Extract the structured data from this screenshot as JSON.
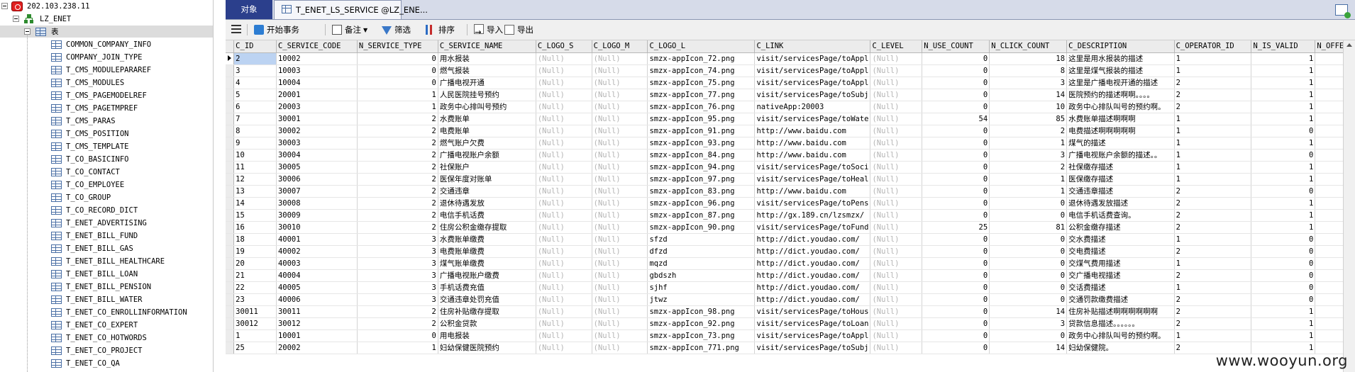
{
  "tree": {
    "connection": "202.103.238.11",
    "database": "LZ_ENET",
    "folder": "表",
    "tables": [
      "COMMON_COMPANY_INFO",
      "COMPANY_JOIN_TYPE",
      "T_CMS_MODULEPARAREF",
      "T_CMS_MODULES",
      "T_CMS_PAGEMODELREF",
      "T_CMS_PAGETMPREF",
      "T_CMS_PARAS",
      "T_CMS_POSITION",
      "T_CMS_TEMPLATE",
      "T_CO_BASICINFO",
      "T_CO_CONTACT",
      "T_CO_EMPLOYEE",
      "T_CO_GROUP",
      "T_CO_RECORD_DICT",
      "T_ENET_ADVERTISING",
      "T_ENET_BILL_FUND",
      "T_ENET_BILL_GAS",
      "T_ENET_BILL_HEALTHCARE",
      "T_ENET_BILL_LOAN",
      "T_ENET_BILL_PENSION",
      "T_ENET_BILL_WATER",
      "T_ENET_CO_ENROLLINFORMATION",
      "T_ENET_CO_EXPERT",
      "T_ENET_CO_HOTWORDS",
      "T_ENET_CO_PROJECT",
      "T_ENET_CO_QA"
    ]
  },
  "tabs": {
    "objects": "对象",
    "table": "T_ENET_LS_SERVICE @LZ_ENE..."
  },
  "toolbar": {
    "begin_tx": "开始事务",
    "note": "备注",
    "filter": "筛选",
    "sort": "排序",
    "import": "导入",
    "export": "导出"
  },
  "grid": {
    "columns": [
      "C_ID",
      "C_SERVICE_CODE",
      "N_SERVICE_TYPE",
      "C_SERVICE_NAME",
      "C_LOGO_S",
      "C_LOGO_M",
      "C_LOGO_L",
      "C_LINK",
      "C_LEVEL",
      "N_USE_COUNT",
      "N_CLICK_COUNT",
      "C_DESCRIPTION",
      "C_OPERATOR_ID",
      "N_IS_VALID",
      "N_OFFERI"
    ],
    "rows": [
      [
        "2",
        "10002",
        "0",
        "用水报装",
        "(Null)",
        "(Null)",
        "smzx-appIcon_72.png",
        "visit/servicesPage/toAppl",
        "(Null)",
        "0",
        "18",
        "这里是用水报装的描述",
        "1",
        "1",
        ""
      ],
      [
        "3",
        "10003",
        "0",
        "燃气报装",
        "(Null)",
        "(Null)",
        "smzx-appIcon_74.png",
        "visit/servicesPage/toAppl",
        "(Null)",
        "0",
        "8",
        "这里是煤气报装的描述",
        "1",
        "1",
        ""
      ],
      [
        "4",
        "10004",
        "0",
        "广播电视开通",
        "(Null)",
        "(Null)",
        "smzx-appIcon_75.png",
        "visit/servicesPage/toAppl",
        "(Null)",
        "0",
        "3",
        "这里是广播电视开通的描述",
        "2",
        "1",
        ""
      ],
      [
        "5",
        "20001",
        "1",
        "人民医院挂号预约",
        "(Null)",
        "(Null)",
        "smzx-appIcon_77.png",
        "visit/servicesPage/toSubj",
        "(Null)",
        "0",
        "14",
        "医院预约的描述啊啊。。。。",
        "2",
        "1",
        ""
      ],
      [
        "6",
        "20003",
        "1",
        "政务中心排叫号预约",
        "(Null)",
        "(Null)",
        "smzx-appIcon_76.png",
        "nativeApp:20003",
        "(Null)",
        "0",
        "10",
        "政务中心排队叫号的预约啊。",
        "2",
        "1",
        ""
      ],
      [
        "7",
        "30001",
        "2",
        "水费账单",
        "(Null)",
        "(Null)",
        "smzx-appIcon_95.png",
        "visit/servicesPage/toWate",
        "(Null)",
        "54",
        "85",
        "水费账单描述啊啊啊",
        "1",
        "1",
        ""
      ],
      [
        "8",
        "30002",
        "2",
        "电费账单",
        "(Null)",
        "(Null)",
        "smzx-appIcon_91.png",
        "http://www.baidu.com",
        "(Null)",
        "0",
        "2",
        "电费描述啊啊啊啊啊",
        "1",
        "0",
        ""
      ],
      [
        "9",
        "30003",
        "2",
        "燃气账户欠费",
        "(Null)",
        "(Null)",
        "smzx-appIcon_93.png",
        "http://www.baidu.com",
        "(Null)",
        "0",
        "1",
        "煤气的描述",
        "1",
        "1",
        ""
      ],
      [
        "10",
        "30004",
        "2",
        "广播电视账户余额",
        "(Null)",
        "(Null)",
        "smzx-appIcon_84.png",
        "http://www.baidu.com",
        "(Null)",
        "0",
        "3",
        "广播电视账户余额的描述。。",
        "1",
        "0",
        ""
      ],
      [
        "11",
        "30005",
        "2",
        "社保账户",
        "(Null)",
        "(Null)",
        "smzx-appIcon_94.png",
        "visit/servicesPage/toSoci",
        "(Null)",
        "0",
        "2",
        "社保缴存描述",
        "1",
        "1",
        ""
      ],
      [
        "12",
        "30006",
        "2",
        "医保年度对账单",
        "(Null)",
        "(Null)",
        "smzx-appIcon_97.png",
        "visit/servicesPage/toHeal",
        "(Null)",
        "0",
        "1",
        "医保缴存描述",
        "1",
        "1",
        ""
      ],
      [
        "13",
        "30007",
        "2",
        "交通违章",
        "(Null)",
        "(Null)",
        "smzx-appIcon_83.png",
        "http://www.baidu.com",
        "(Null)",
        "0",
        "1",
        "交通违章描述",
        "2",
        "0",
        ""
      ],
      [
        "14",
        "30008",
        "2",
        "退休待遇发放",
        "(Null)",
        "(Null)",
        "smzx-appIcon_96.png",
        "visit/servicesPage/toPens",
        "(Null)",
        "0",
        "0",
        "退休待遇发放描述",
        "2",
        "1",
        ""
      ],
      [
        "15",
        "30009",
        "2",
        "电信手机话费",
        "(Null)",
        "(Null)",
        "smzx-appIcon_87.png",
        "http://gx.189.cn/lzsmzx/",
        "(Null)",
        "0",
        "0",
        "电信手机话费查询。",
        "2",
        "1",
        ""
      ],
      [
        "16",
        "30010",
        "2",
        "住房公积金缴存提取",
        "(Null)",
        "(Null)",
        "smzx-appIcon_90.png",
        "visit/servicesPage/toFund",
        "(Null)",
        "25",
        "81",
        "公积金缴存描述",
        "2",
        "1",
        ""
      ],
      [
        "18",
        "40001",
        "3",
        "水费账单缴费",
        "(Null)",
        "(Null)",
        "sfzd",
        "http://dict.youdao.com/",
        "(Null)",
        "0",
        "0",
        "交水费描述",
        "1",
        "0",
        ""
      ],
      [
        "19",
        "40002",
        "3",
        "电费账单缴费",
        "(Null)",
        "(Null)",
        "dfzd",
        "http://dict.youdao.com/",
        "(Null)",
        "0",
        "0",
        "交电费描述",
        "2",
        "0",
        ""
      ],
      [
        "20",
        "40003",
        "3",
        "煤气账单缴费",
        "(Null)",
        "(Null)",
        "mqzd",
        "http://dict.youdao.com/",
        "(Null)",
        "0",
        "0",
        "交煤气费用描述",
        "1",
        "0",
        ""
      ],
      [
        "21",
        "40004",
        "3",
        "广播电视账户缴费",
        "(Null)",
        "(Null)",
        "gbdszh",
        "http://dict.youdao.com/",
        "(Null)",
        "0",
        "0",
        "交广播电视描述",
        "2",
        "0",
        ""
      ],
      [
        "22",
        "40005",
        "3",
        "手机话费充值",
        "(Null)",
        "(Null)",
        "sjhf",
        "http://dict.youdao.com/",
        "(Null)",
        "0",
        "0",
        "交话费描述",
        "1",
        "0",
        ""
      ],
      [
        "23",
        "40006",
        "3",
        "交通违章处罚充值",
        "(Null)",
        "(Null)",
        "jtwz",
        "http://dict.youdao.com/",
        "(Null)",
        "0",
        "0",
        "交通罚款缴费描述",
        "2",
        "0",
        ""
      ],
      [
        "30011",
        "30011",
        "2",
        "住房补贴缴存提取",
        "(Null)",
        "(Null)",
        "smzx-appIcon_98.png",
        "visit/servicesPage/toHous",
        "(Null)",
        "0",
        "14",
        "住房补贴描述啊啊啊啊啊啊",
        "2",
        "1",
        ""
      ],
      [
        "30012",
        "30012",
        "2",
        "公积金贷款",
        "(Null)",
        "(Null)",
        "smzx-appIcon_92.png",
        "visit/servicesPage/toLoan",
        "(Null)",
        "0",
        "3",
        "贷款信息描述。。。。。。",
        "2",
        "1",
        ""
      ],
      [
        "1",
        "10001",
        "0",
        "用电报装",
        "(Null)",
        "(Null)",
        "smzx-appIcon_73.png",
        "visit/servicesPage/toAppl",
        "(Null)",
        "0",
        "0",
        "政务中心排队叫号的预约啊。",
        "1",
        "1",
        ""
      ],
      [
        "25",
        "20002",
        "1",
        "妇幼保健医院预约",
        "(Null)",
        "(Null)",
        "smzx-appIcon_771.png",
        "visit/servicesPage/toSubj",
        "(Null)",
        "0",
        "14",
        "妇幼保健院。",
        "2",
        "1",
        ""
      ]
    ]
  },
  "watermark": "www.wooyun.org",
  "colors": {
    "tab_active": "#2b3f8c",
    "null_text": "#b4b4b4",
    "selection": "#bcd3f2"
  }
}
